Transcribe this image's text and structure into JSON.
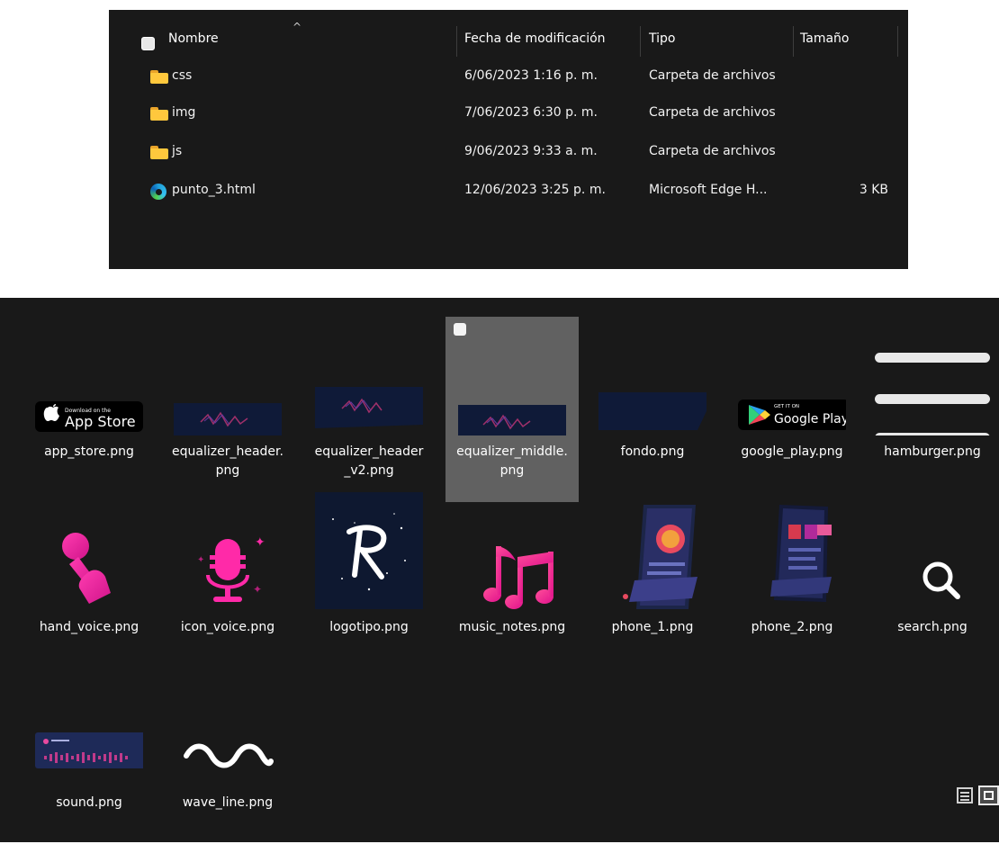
{
  "details_view": {
    "columns": [
      {
        "label": "Nombre"
      },
      {
        "label": "Fecha de modificación"
      },
      {
        "label": "Tipo"
      },
      {
        "label": "Tamaño"
      }
    ],
    "rows": [
      {
        "name": "css",
        "date": "6/06/2023 1:16 p. m.",
        "type": "Carpeta de archivos",
        "size": "",
        "icon": "folder-icon"
      },
      {
        "name": "img",
        "date": "7/06/2023 6:30 p. m.",
        "type": "Carpeta de archivos",
        "size": "",
        "icon": "folder-icon"
      },
      {
        "name": "js",
        "date": "9/06/2023 9:33 a. m.",
        "type": "Carpeta de archivos",
        "size": "",
        "icon": "folder-icon"
      },
      {
        "name": "punto_3.html",
        "date": "12/06/2023 3:25 p. m.",
        "type": "Microsoft Edge H...",
        "size": "3 KB",
        "icon": "edge-browser-icon"
      }
    ]
  },
  "icons_view": {
    "files": [
      {
        "label": "app_store.png",
        "badge_small": "Download on the",
        "badge_big": "App Store"
      },
      {
        "label": "equalizer_header.\npng"
      },
      {
        "label": "equalizer_header\n_v2.png"
      },
      {
        "label": "equalizer_middle.\npng",
        "selected": true
      },
      {
        "label": "fondo.png"
      },
      {
        "label": "google_play.png",
        "badge_small": "GET IT ON",
        "badge_big": "Google Play"
      },
      {
        "label": "hamburger.png"
      },
      {
        "label": "hand_voice.png"
      },
      {
        "label": "icon_voice.png"
      },
      {
        "label": "logotipo.png"
      },
      {
        "label": "music_notes.png"
      },
      {
        "label": "phone_1.png"
      },
      {
        "label": "phone_2.png"
      },
      {
        "label": "search.png"
      },
      {
        "label": "sound.png"
      },
      {
        "label": "wave_line.png"
      }
    ]
  },
  "colors": {
    "panel_bg": "#191919",
    "selected_tile": "#616161",
    "folder_yellow": "#ffc83d",
    "magenta": "#ff2aa8"
  }
}
